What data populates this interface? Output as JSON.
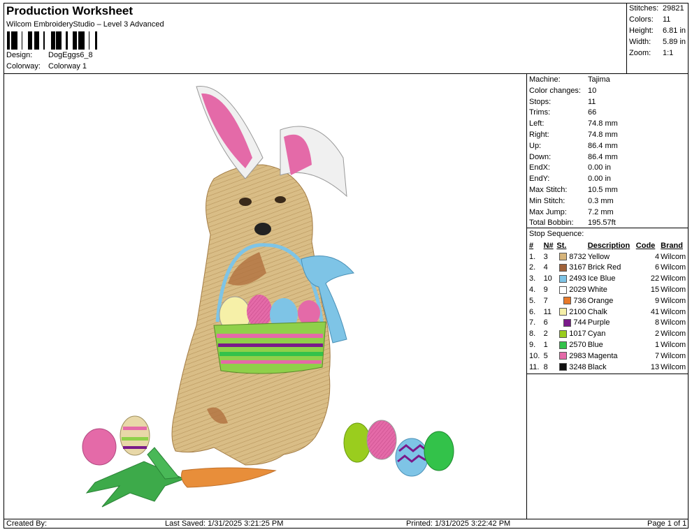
{
  "header": {
    "title": "Production Worksheet",
    "subtitle": "Wilcom EmbroideryStudio – Level 3 Advanced",
    "design_label": "Design:",
    "design_value": "DogEggs6_8",
    "colorway_label": "Colorway:",
    "colorway_value": "Colorway 1"
  },
  "stats": [
    {
      "label": "Stitches:",
      "value": "29821"
    },
    {
      "label": "Colors:",
      "value": "11"
    },
    {
      "label": "Height:",
      "value": "6.81 in"
    },
    {
      "label": "Width:",
      "value": "5.89 in"
    },
    {
      "label": "Zoom:",
      "value": "1:1"
    }
  ],
  "machine_info": [
    {
      "label": "Machine:",
      "value": "Tajima"
    },
    {
      "label": "Color changes:",
      "value": "10"
    },
    {
      "label": "Stops:",
      "value": "11"
    },
    {
      "label": "Trims:",
      "value": "66"
    },
    {
      "label": "Left:",
      "value": "74.8 mm"
    },
    {
      "label": "Right:",
      "value": "74.8 mm"
    },
    {
      "label": "Up:",
      "value": "86.4 mm"
    },
    {
      "label": "Down:",
      "value": "86.4 mm"
    },
    {
      "label": "EndX:",
      "value": "0.00 in"
    },
    {
      "label": "EndY:",
      "value": "0.00 in"
    },
    {
      "label": "Max Stitch:",
      "value": "10.5 mm"
    },
    {
      "label": "Min Stitch:",
      "value": "0.3 mm"
    },
    {
      "label": "Max Jump:",
      "value": "7.2 mm"
    },
    {
      "label": "Total Bobbin:",
      "value": "195.57ft"
    }
  ],
  "stop_sequence": {
    "title": "Stop Sequence:",
    "columns": [
      "#",
      "N#",
      "St.",
      "Description",
      "Code",
      "Brand"
    ],
    "rows": [
      {
        "idx": "1.",
        "n": "3",
        "color": "#d6b47a",
        "st": "8732",
        "desc": "Yellow",
        "code": "4",
        "brand": "Wilcom"
      },
      {
        "idx": "2.",
        "n": "4",
        "color": "#a0623a",
        "st": "3167",
        "desc": "Brick Red",
        "code": "6",
        "brand": "Wilcom"
      },
      {
        "idx": "3.",
        "n": "10",
        "color": "#7ec4e6",
        "st": "2493",
        "desc": "Ice Blue",
        "code": "22",
        "brand": "Wilcom"
      },
      {
        "idx": "4.",
        "n": "9",
        "color": "#ffffff",
        "st": "2029",
        "desc": "White",
        "code": "15",
        "brand": "Wilcom"
      },
      {
        "idx": "5.",
        "n": "7",
        "color": "#e87a2a",
        "st": "736",
        "desc": "Orange",
        "code": "9",
        "brand": "Wilcom"
      },
      {
        "idx": "6.",
        "n": "11",
        "color": "#f6f0a8",
        "st": "2100",
        "desc": "Chalk",
        "code": "41",
        "brand": "Wilcom"
      },
      {
        "idx": "7.",
        "n": "6",
        "color": "#7a1a8a",
        "st": "744",
        "desc": "Purple",
        "code": "8",
        "brand": "Wilcom"
      },
      {
        "idx": "8.",
        "n": "2",
        "color": "#9acd1e",
        "st": "1017",
        "desc": "Cyan",
        "code": "2",
        "brand": "Wilcom"
      },
      {
        "idx": "9.",
        "n": "1",
        "color": "#33c24a",
        "st": "2570",
        "desc": "Blue",
        "code": "1",
        "brand": "Wilcom"
      },
      {
        "idx": "10.",
        "n": "5",
        "color": "#e46aa8",
        "st": "2983",
        "desc": "Magenta",
        "code": "7",
        "brand": "Wilcom"
      },
      {
        "idx": "11.",
        "n": "8",
        "color": "#111111",
        "st": "3248",
        "desc": "Black",
        "code": "13",
        "brand": "Wilcom"
      }
    ]
  },
  "footer": {
    "created_by": "Created By:",
    "last_saved": "Last Saved: 1/31/2025 3:21:25 PM",
    "printed": "Printed: 1/31/2025 3:22:42 PM",
    "page": "Page 1 of 1"
  }
}
